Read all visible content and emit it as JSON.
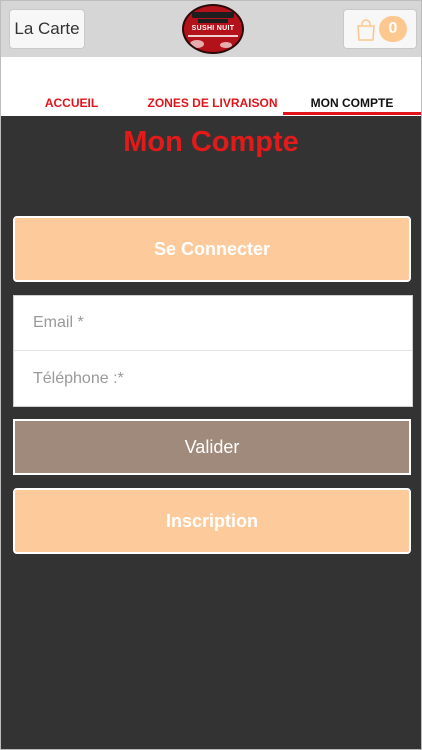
{
  "header": {
    "carte_label": "La Carte",
    "logo_text": "SUSHI NUIT",
    "cart_count": "0"
  },
  "nav": {
    "tabs": [
      {
        "label": "ACCUEIL",
        "active": false
      },
      {
        "label": "ZONES DE LIVRAISON",
        "active": false
      },
      {
        "label": "MON COMPTE",
        "active": true
      }
    ]
  },
  "main": {
    "title": "Mon Compte",
    "connect_label": "Se Connecter",
    "email_placeholder": "Email *",
    "phone_placeholder": "Téléphone :*",
    "valider_label": "Valider",
    "inscription_label": "Inscription"
  },
  "colors": {
    "accent_red": "#e0141a",
    "peach": "#fdcb9b",
    "valider": "#a08a7c",
    "background_dark": "#333333"
  }
}
